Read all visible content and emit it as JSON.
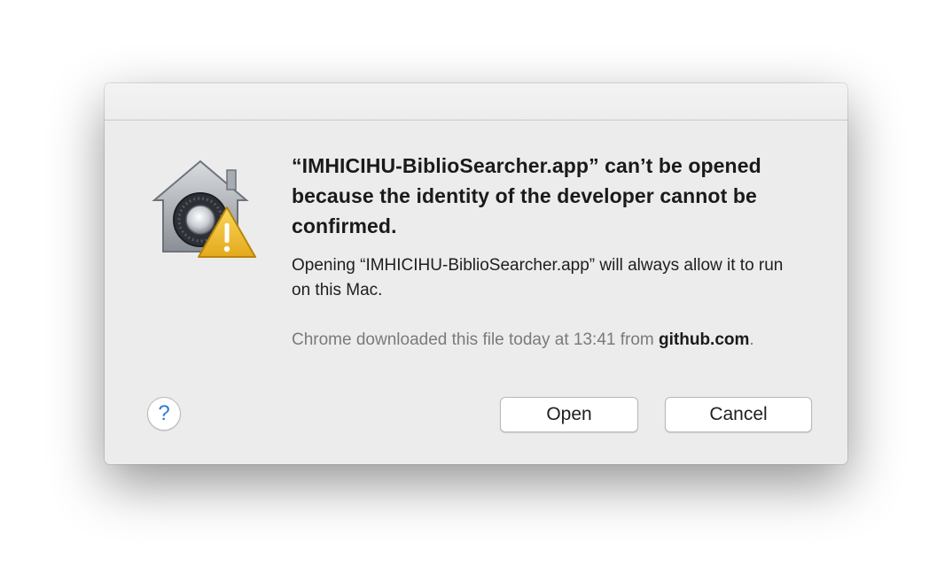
{
  "dialog": {
    "headline": "“IMHICIHU-BiblioSearcher.app” can’t be opened because the identity of the developer cannot be confirmed.",
    "body": "Opening “IMHICIHU-BiblioSearcher.app” will always allow it to run on this Mac.",
    "source_prefix": "Chrome downloaded this file today at 13:41 from ",
    "source_domain": "github.com",
    "source_suffix": ".",
    "icon": "gatekeeper-security-warning-icon"
  },
  "buttons": {
    "help_label": "?",
    "open_label": "Open",
    "cancel_label": "Cancel"
  },
  "colors": {
    "dialog_bg": "#ececec",
    "help_accent": "#2f7bd9",
    "warning_yellow": "#f2c232"
  }
}
